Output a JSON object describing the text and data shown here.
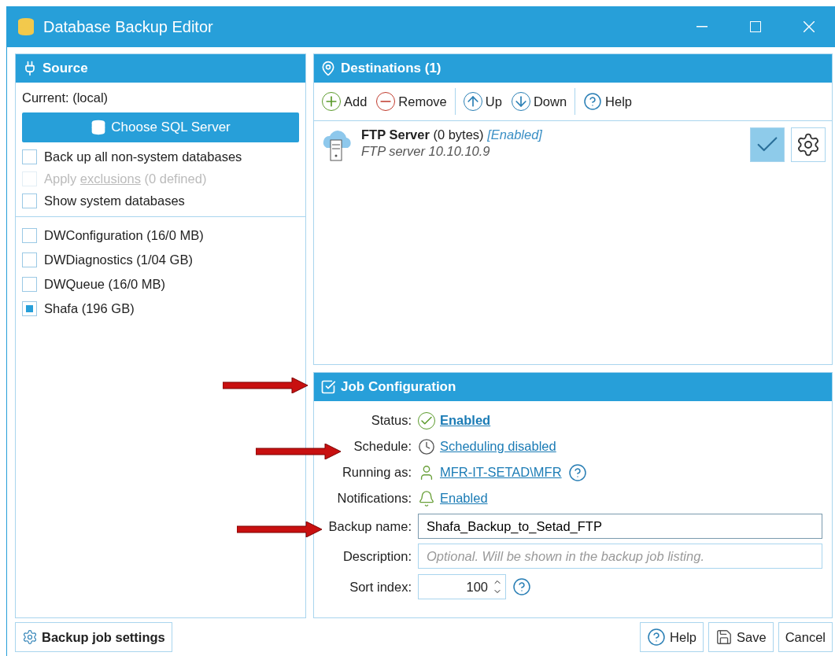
{
  "window": {
    "title": "Database Backup Editor"
  },
  "source": {
    "title": "Source",
    "current": "Current: (local)",
    "choose_button": "Choose SQL Server",
    "options": [
      {
        "label": "Back up all non-system databases",
        "checked": false,
        "disabled": false
      },
      {
        "label": "Apply **exclusions** (0 defined)",
        "checked": false,
        "disabled": true
      },
      {
        "label": "Show system databases",
        "checked": false,
        "disabled": false
      }
    ],
    "databases": [
      {
        "label": "DWConfiguration (16/0 MB)",
        "checked": false
      },
      {
        "label": "DWDiagnostics (1/04 GB)",
        "checked": false
      },
      {
        "label": "DWQueue (16/0 MB)",
        "checked": false
      },
      {
        "label": "Shafa (196 GB)",
        "checked": true
      }
    ]
  },
  "destinations": {
    "title": "Destinations (1)",
    "toolbar": [
      {
        "kind": "add",
        "label": "Add"
      },
      {
        "kind": "remove",
        "label": "Remove"
      },
      {
        "kind": "separator"
      },
      {
        "kind": "up",
        "label": "Up"
      },
      {
        "kind": "down",
        "label": "Down"
      },
      {
        "kind": "separator"
      },
      {
        "kind": "help",
        "label": "Help"
      }
    ],
    "items": [
      {
        "name": "FTP Server",
        "size": "(0 bytes)",
        "status": "[Enabled]",
        "detail": "FTP server 10.10.10.9",
        "checked": true
      }
    ]
  },
  "job_configuration": {
    "title": "Job Configuration",
    "checked": true,
    "arrow": true,
    "rows": [
      {
        "kind": "status",
        "label": "Status:",
        "value": "Enabled",
        "bold": true,
        "help": false,
        "arrow": false
      },
      {
        "kind": "schedule",
        "label": "Schedule:",
        "value": "Scheduling disabled",
        "bold": false,
        "help": false,
        "arrow": true
      },
      {
        "kind": "account",
        "label": "Running as:",
        "value": "MFR-IT-SETAD\\MFR",
        "bold": false,
        "help": true,
        "arrow": false
      },
      {
        "kind": "notifications",
        "label": "Notifications:",
        "value": "Enabled",
        "bold": false,
        "help": false,
        "arrow": false
      },
      {
        "kind": "text",
        "label": "Backup name:",
        "value": "Shafa_Backup_to_Setad_FTP",
        "arrow": true
      },
      {
        "kind": "text",
        "label": "Description:",
        "placeholder": "Optional. Will be shown in the backup job listing.",
        "arrow": false
      },
      {
        "kind": "number",
        "label": "Sort index:",
        "value": "100",
        "help": true,
        "arrow": false
      }
    ]
  },
  "footer": {
    "settings_button": "Backup job settings",
    "buttons": [
      {
        "kind": "help",
        "label": "Help"
      },
      {
        "kind": "save",
        "label": "Save"
      },
      {
        "kind": "cancel",
        "label": "Cancel"
      }
    ]
  }
}
